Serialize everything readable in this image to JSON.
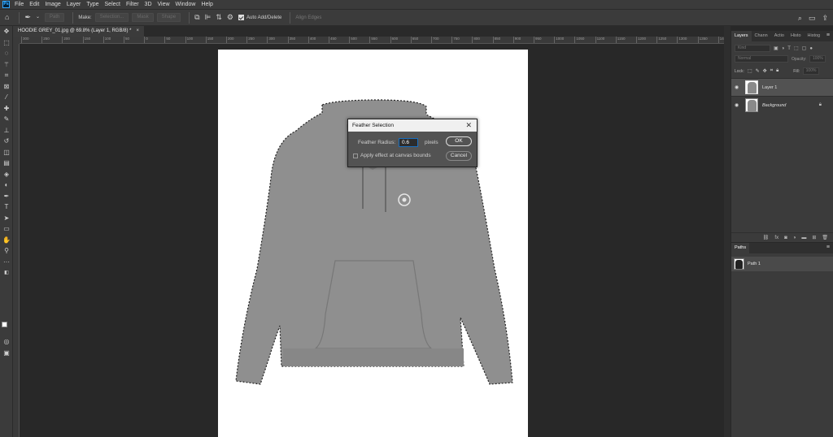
{
  "app": {
    "logo_text": "Ps"
  },
  "menu": [
    "File",
    "Edit",
    "Image",
    "Layer",
    "Type",
    "Select",
    "Filter",
    "3D",
    "View",
    "Window",
    "Help"
  ],
  "options": {
    "mode_field": "Path",
    "make_label": "Make:",
    "selection_button": "Selection...",
    "mask_button": "Mask",
    "shape_button": "Shape",
    "auto_add_delete": "Auto Add/Delete",
    "align_edges": "Align Edges"
  },
  "document_tab": {
    "title": "HOODIE GREY_01.jpg @ 69.8% (Layer 1, RGB/8) *",
    "close": "×"
  },
  "ruler_ticks": [
    "300",
    "250",
    "200",
    "150",
    "100",
    "50",
    "0",
    "50",
    "100",
    "150",
    "200",
    "250",
    "300",
    "350",
    "400",
    "450",
    "500",
    "550",
    "600",
    "650",
    "700",
    "750",
    "800",
    "850",
    "900",
    "950",
    "1000",
    "1050",
    "1100",
    "1150",
    "1200",
    "1250",
    "1300",
    "1350",
    "1400",
    "1450",
    "1500",
    "1550",
    "1600",
    "1650"
  ],
  "layers_panel": {
    "tabs": [
      "Layers",
      "Chann",
      "Actio",
      "Histo",
      "Histog"
    ],
    "kind_placeholder": "Kind",
    "blend_mode": "Normal",
    "opacity_label": "Opacity:",
    "opacity_value": "100%",
    "lock_label": "Lock:",
    "fill_label": "Fill:",
    "fill_value": "100%",
    "layers": [
      {
        "name": "Layer 1",
        "selected": true
      },
      {
        "name": "Background",
        "selected": false
      }
    ]
  },
  "paths_panel": {
    "tab": "Paths",
    "paths": [
      {
        "name": "Path 1"
      }
    ]
  },
  "dialog": {
    "title": "Feather Selection",
    "radius_label": "Feather Radius:",
    "radius_value": "0.6",
    "unit": "pixels",
    "ok": "OK",
    "cancel": "Cancel",
    "apply_label": "Apply effect at canvas bounds",
    "apply_checked": false
  }
}
